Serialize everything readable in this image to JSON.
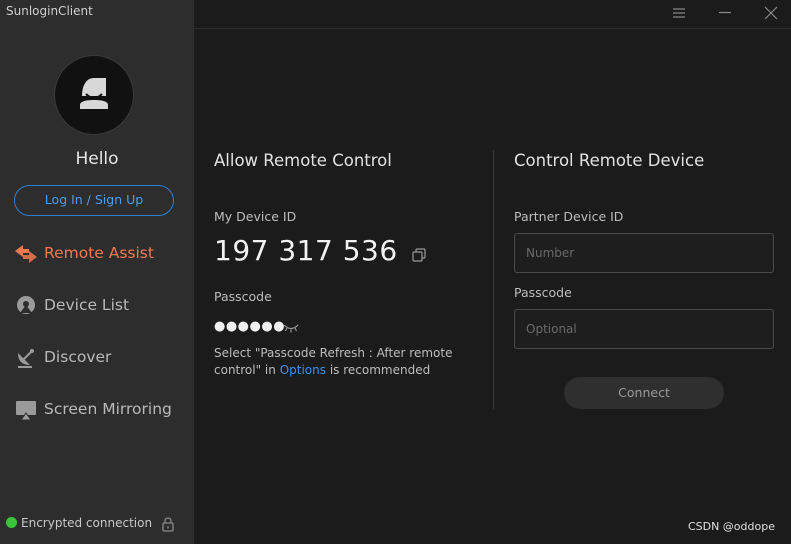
{
  "app": {
    "title": "SunloginClient"
  },
  "sidebar": {
    "greeting": "Hello",
    "login_label": "Log In / Sign Up",
    "items": [
      {
        "label": "Remote Assist",
        "icon": "remote-assist-icon",
        "active": true
      },
      {
        "label": "Device List",
        "icon": "device-list-icon",
        "active": false
      },
      {
        "label": "Discover",
        "icon": "satellite-dish-icon",
        "active": false
      },
      {
        "label": "Screen Mirroring",
        "icon": "screen-mirroring-icon",
        "active": false
      }
    ],
    "status": {
      "label": "Encrypted connection",
      "color": "#3bc43b"
    }
  },
  "colors": {
    "accent": "#ef7a52",
    "link": "#3e90e8"
  },
  "allow": {
    "title": "Allow Remote Control",
    "device_id_label": "My Device ID",
    "device_id": "197 317 536",
    "passcode_label": "Passcode",
    "passcode_masked": "●●●●●●",
    "hint_before": "Select \"Passcode Refresh : After remote control\" in ",
    "hint_link": "Options",
    "hint_after": " is recommended"
  },
  "control": {
    "title": "Control Remote Device",
    "partner_label": "Partner Device ID",
    "partner_placeholder": "Number",
    "passcode_label": "Passcode",
    "passcode_placeholder": "Optional",
    "connect_label": "Connect"
  },
  "watermark": "CSDN @oddope"
}
